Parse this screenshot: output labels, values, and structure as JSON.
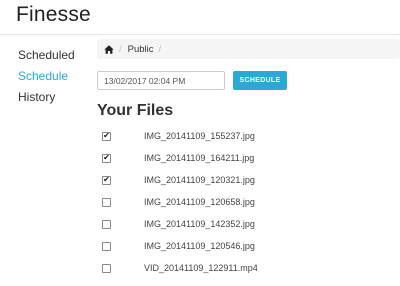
{
  "app": {
    "title": "Finesse"
  },
  "sidebar": {
    "items": [
      {
        "label": "Scheduled",
        "active": false
      },
      {
        "label": "Schedule",
        "active": true
      },
      {
        "label": "History",
        "active": false
      }
    ]
  },
  "breadcrumb": {
    "home_icon": "home-icon",
    "items": [
      {
        "label": "Public"
      }
    ]
  },
  "schedule": {
    "datetime_value": "13/02/2017 02:04 PM",
    "button_label": "SCHEDULE"
  },
  "files": {
    "title": "Your Files",
    "items": [
      {
        "name": "IMG_20141109_155237.jpg",
        "checked": true
      },
      {
        "name": "IMG_20141109_164211.jpg",
        "checked": true
      },
      {
        "name": "IMG_20141109_120321.jpg",
        "checked": true
      },
      {
        "name": "IMG_20141109_120658.jpg",
        "checked": false
      },
      {
        "name": "IMG_20141109_142352.jpg",
        "checked": false
      },
      {
        "name": "IMG_20141109_120546.jpg",
        "checked": false
      },
      {
        "name": "VID_20141109_122911.mp4",
        "checked": false
      }
    ]
  },
  "colors": {
    "accent": "#2aa8d6",
    "breadcrumb_bg": "#f5f5f5",
    "text": "#333333"
  }
}
